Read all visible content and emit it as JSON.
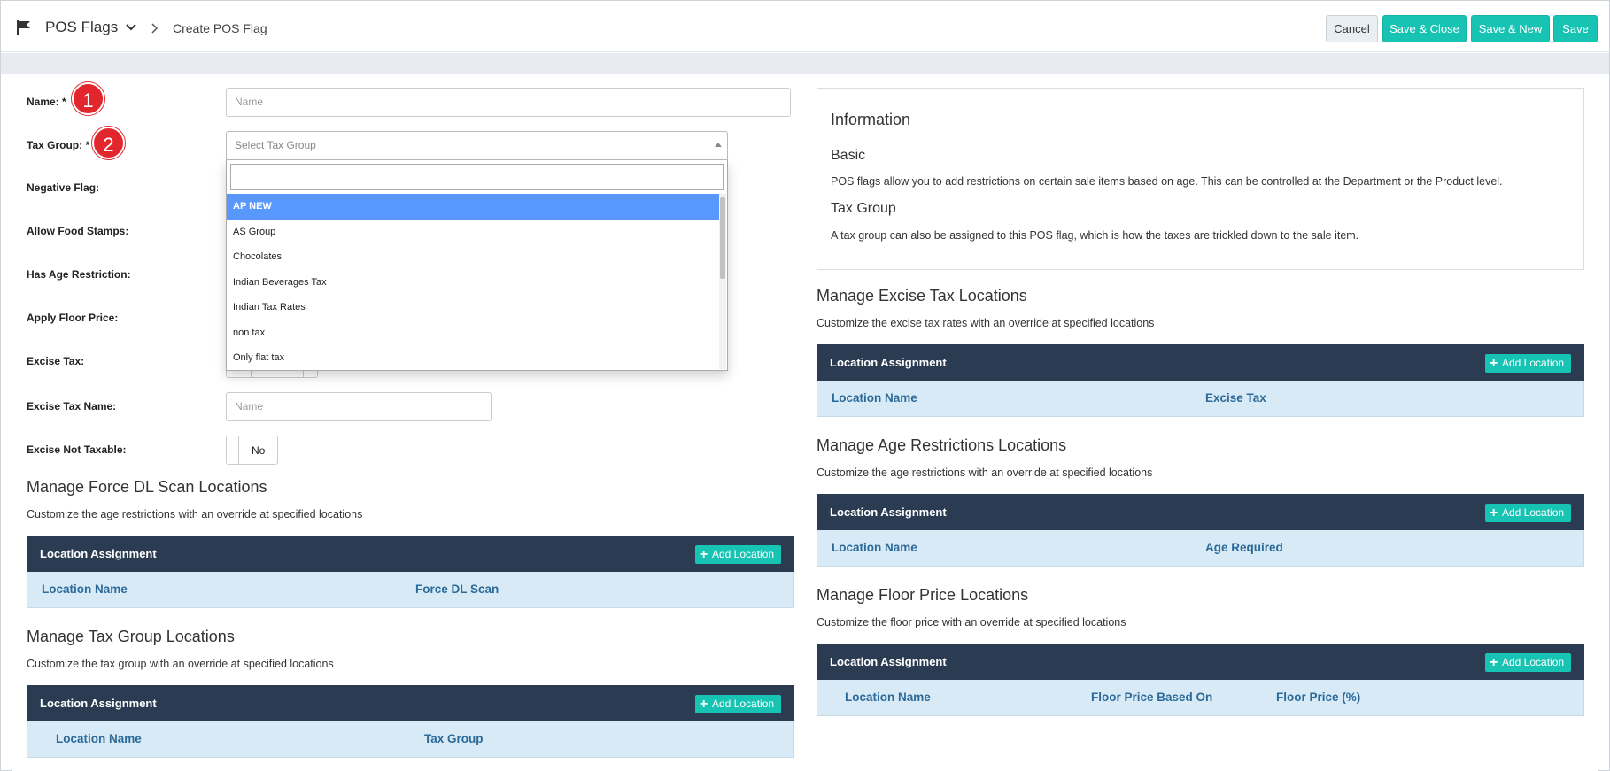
{
  "header": {
    "app_title": "POS Flags",
    "breadcrumb": "Create POS Flag",
    "buttons": {
      "cancel": "Cancel",
      "save_close": "Save & Close",
      "save_new": "Save & New",
      "save": "Save"
    },
    "accent_color": "#17c3b2"
  },
  "form": {
    "name_label": "Name: *",
    "name_placeholder": "Name",
    "name_badge": "1",
    "tax_group_label": "Tax Group: *",
    "tax_group_placeholder": "Select Tax Group",
    "tax_group_badge": "2",
    "tax_group_options": [
      "AP NEW",
      "AS Group",
      "Chocolates",
      "Indian Beverages Tax",
      "Indian Tax Rates",
      "non tax",
      "Only flat tax"
    ],
    "tax_group_highlighted": "AP NEW",
    "negative_flag_label": "Negative Flag:",
    "food_stamps_label": "Allow Food Stamps:",
    "age_restriction_label": "Has Age Restriction:",
    "floor_price_label": "Apply Floor Price:",
    "excise_tax_label": "Excise Tax:",
    "excise_tax_name_label": "Excise Tax Name:",
    "excise_tax_name_placeholder": "Name",
    "excise_not_taxable_label": "Excise Not Taxable:",
    "excise_not_taxable_value": "No"
  },
  "left_sections": [
    {
      "title": "Manage Force DL Scan Locations",
      "subtitle": "Customize the age restrictions with an override at specified locations",
      "table_title": "Location Assignment",
      "add_label": "Add Location",
      "columns": [
        "Location Name",
        "Force DL Scan"
      ]
    },
    {
      "title": "Manage Tax Group Locations",
      "subtitle": "Customize the tax group with an override at specified locations",
      "table_title": "Location Assignment",
      "add_label": "Add Location",
      "columns": [
        "Location Name",
        "Tax Group"
      ]
    }
  ],
  "info": {
    "heading": "Information",
    "basic_title": "Basic",
    "basic_text": "POS flags allow you to add restrictions on certain sale items based on age. This can be controlled at the Department or the Product level.",
    "tax_title": "Tax Group",
    "tax_text": "A tax group can also be assigned to this POS flag, which is how the taxes are trickled down to the sale item."
  },
  "right_sections": [
    {
      "title": "Manage Excise Tax Locations",
      "subtitle": "Customize the excise tax rates with an override at specified locations",
      "table_title": "Location Assignment",
      "add_label": "Add Location",
      "columns": [
        "Location Name",
        "Excise Tax"
      ]
    },
    {
      "title": "Manage Age Restrictions Locations",
      "subtitle": "Customize the age restrictions with an override at specified locations",
      "table_title": "Location Assignment",
      "add_label": "Add Location",
      "columns": [
        "Location Name",
        "Age Required"
      ]
    },
    {
      "title": "Manage Floor Price Locations",
      "subtitle": "Customize the floor price with an override at specified locations",
      "table_title": "Location Assignment",
      "add_label": "Add Location",
      "columns": [
        "Location Name",
        "Floor Price Based On",
        "Floor Price (%)"
      ]
    }
  ]
}
